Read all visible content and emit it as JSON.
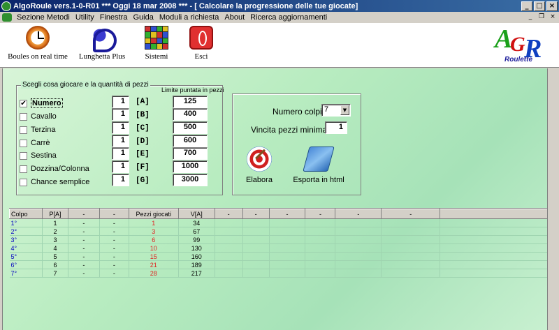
{
  "window": {
    "title": "AlgoRoule vers.1-0-R01  ***  Oggi 18 mar 2008  ***  - [ Calcolare la progressione delle tue giocate]",
    "controls": {
      "minimize": "_",
      "maximize": "□",
      "close": "×"
    }
  },
  "menu": {
    "items": [
      "Sezione Metodi",
      "Utility",
      "Finestra",
      "Guida",
      "Moduli a richiesta",
      "About",
      "Ricerca aggiornamenti"
    ],
    "mdi_controls": {
      "minimize": "_",
      "restore": "❐",
      "close": "×"
    }
  },
  "toolbar": {
    "boules": "Boules on real time",
    "lunghetta": "Lunghetta Plus",
    "sistemi": "Sistemi",
    "esci": "Esci"
  },
  "logo": {
    "letters": [
      "A",
      "G",
      "R"
    ],
    "sub": "Roulette"
  },
  "colors": {
    "title_gradient_start": "#0a246a",
    "title_gradient_end": "#3a6ea5",
    "panel_green": "#b8ecc0",
    "red_value": "#e02020",
    "blue_value": "#0000c0"
  },
  "group1": {
    "legend": "Scegli cosa giocare e la quantità di pezzi",
    "limit_label": "Limite puntata in pezzi",
    "rows": [
      {
        "label": "Numero",
        "checked": true,
        "check_mark": "✔",
        "qty": "1",
        "letter": "[A]",
        "limit": "125"
      },
      {
        "label": "Cavallo",
        "checked": false,
        "check_mark": "",
        "qty": "1",
        "letter": "[B]",
        "limit": "400"
      },
      {
        "label": "Terzina",
        "checked": false,
        "check_mark": "",
        "qty": "1",
        "letter": "[C]",
        "limit": "500"
      },
      {
        "label": "Carrè",
        "checked": false,
        "check_mark": "",
        "qty": "1",
        "letter": "[D]",
        "limit": "600"
      },
      {
        "label": "Sestina",
        "checked": false,
        "check_mark": "",
        "qty": "1",
        "letter": "[E]",
        "limit": "700"
      },
      {
        "label": "Dozzina/Colonna",
        "checked": false,
        "check_mark": "",
        "qty": "1",
        "letter": "[F]",
        "limit": "1000"
      },
      {
        "label": "Chance semplice",
        "checked": false,
        "check_mark": "",
        "qty": "1",
        "letter": "[G]",
        "limit": "3000"
      }
    ]
  },
  "group2": {
    "numero_colpi_label": "Numero colpi",
    "numero_colpi_value": "7",
    "vincita_label": "Vincita pezzi minima",
    "vincita_value": "1",
    "elabora": "Elabora",
    "esporta": "Esporta in html"
  },
  "grid": {
    "headers": [
      "Colpo",
      "P[A]",
      "-",
      "-",
      "Pezzi giocati",
      "V[A]",
      "-",
      "-",
      "-",
      "-",
      "-",
      "-",
      ""
    ],
    "rows": [
      [
        "1°",
        "1",
        "-",
        "-",
        "1",
        "34"
      ],
      [
        "2°",
        "2",
        "-",
        "-",
        "3",
        "67"
      ],
      [
        "3°",
        "3",
        "-",
        "-",
        "6",
        "99"
      ],
      [
        "4°",
        "4",
        "-",
        "-",
        "10",
        "130"
      ],
      [
        "5°",
        "5",
        "-",
        "-",
        "15",
        "160"
      ],
      [
        "6°",
        "6",
        "-",
        "-",
        "21",
        "189"
      ],
      [
        "7°",
        "7",
        "-",
        "-",
        "28",
        "217"
      ]
    ]
  }
}
